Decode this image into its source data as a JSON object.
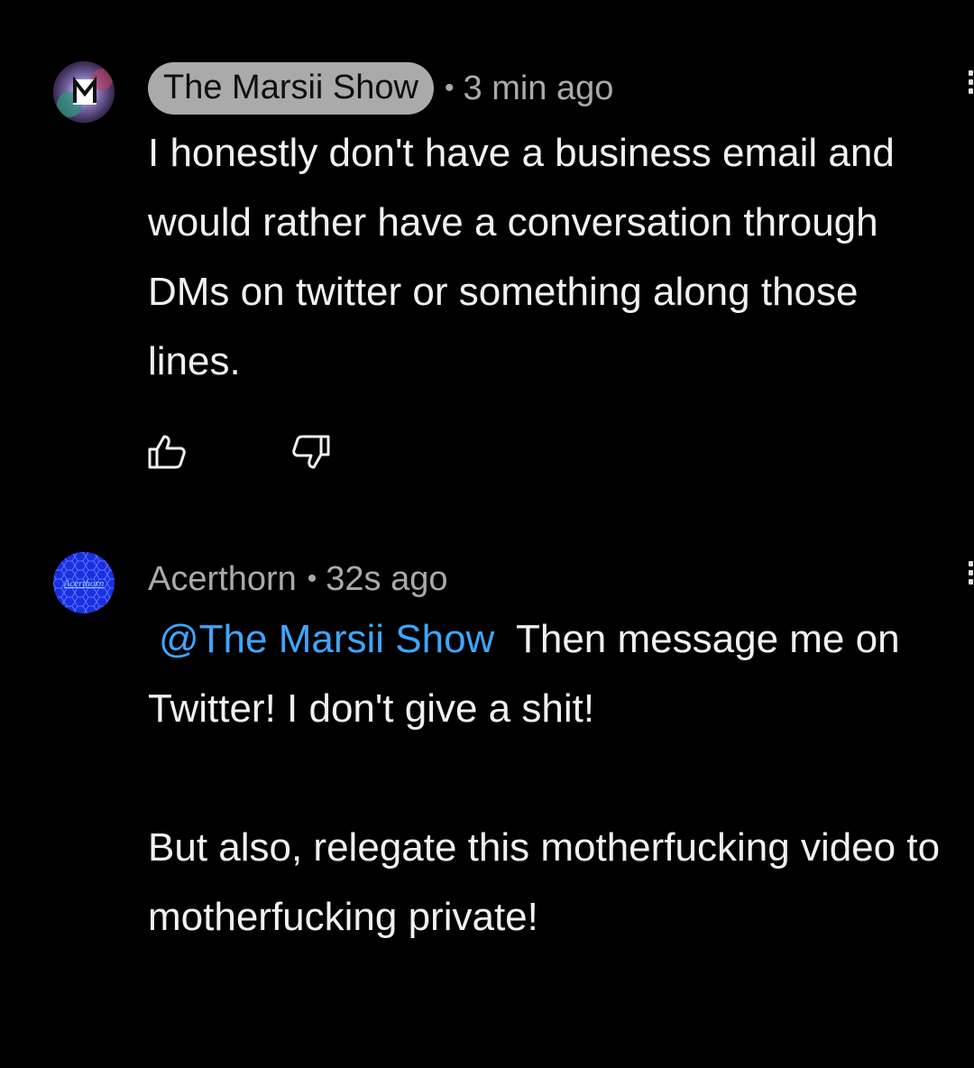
{
  "comments": [
    {
      "author": "The Marsii Show",
      "author_style": "highlighted-chip",
      "separator": "•",
      "time": "3 min ago",
      "avatar_icon": "marsii-m-logo-avatar",
      "text": "I honestly don't have a business email and would rather have a conversation through DMs on twitter or something along those lines.",
      "actions": {
        "like_icon": "thumbs-up-icon",
        "dislike_icon": "thumbs-down-icon"
      },
      "menu_icon": "more-vert-icon"
    },
    {
      "author": "Acerthorn",
      "separator": "•",
      "time": "32s ago",
      "avatar_icon": "acerthorn-hex-avatar",
      "avatar_text": "Acerthorn",
      "mention": "@The Marsii Show",
      "text_after_mention": "Then message me on Twitter! I don't give a shit!\n\nBut also, relegate this motherfucking video to motherfucking private!",
      "menu_icon": "more-vert-icon"
    }
  ],
  "colors": {
    "background": "#000000",
    "text": "#f1f1f1",
    "secondary_text": "#aaaaaa",
    "mention": "#3ea6ff",
    "author_chip": "#aaaaaa",
    "acerthorn_avatar": "#1a2fe0"
  }
}
